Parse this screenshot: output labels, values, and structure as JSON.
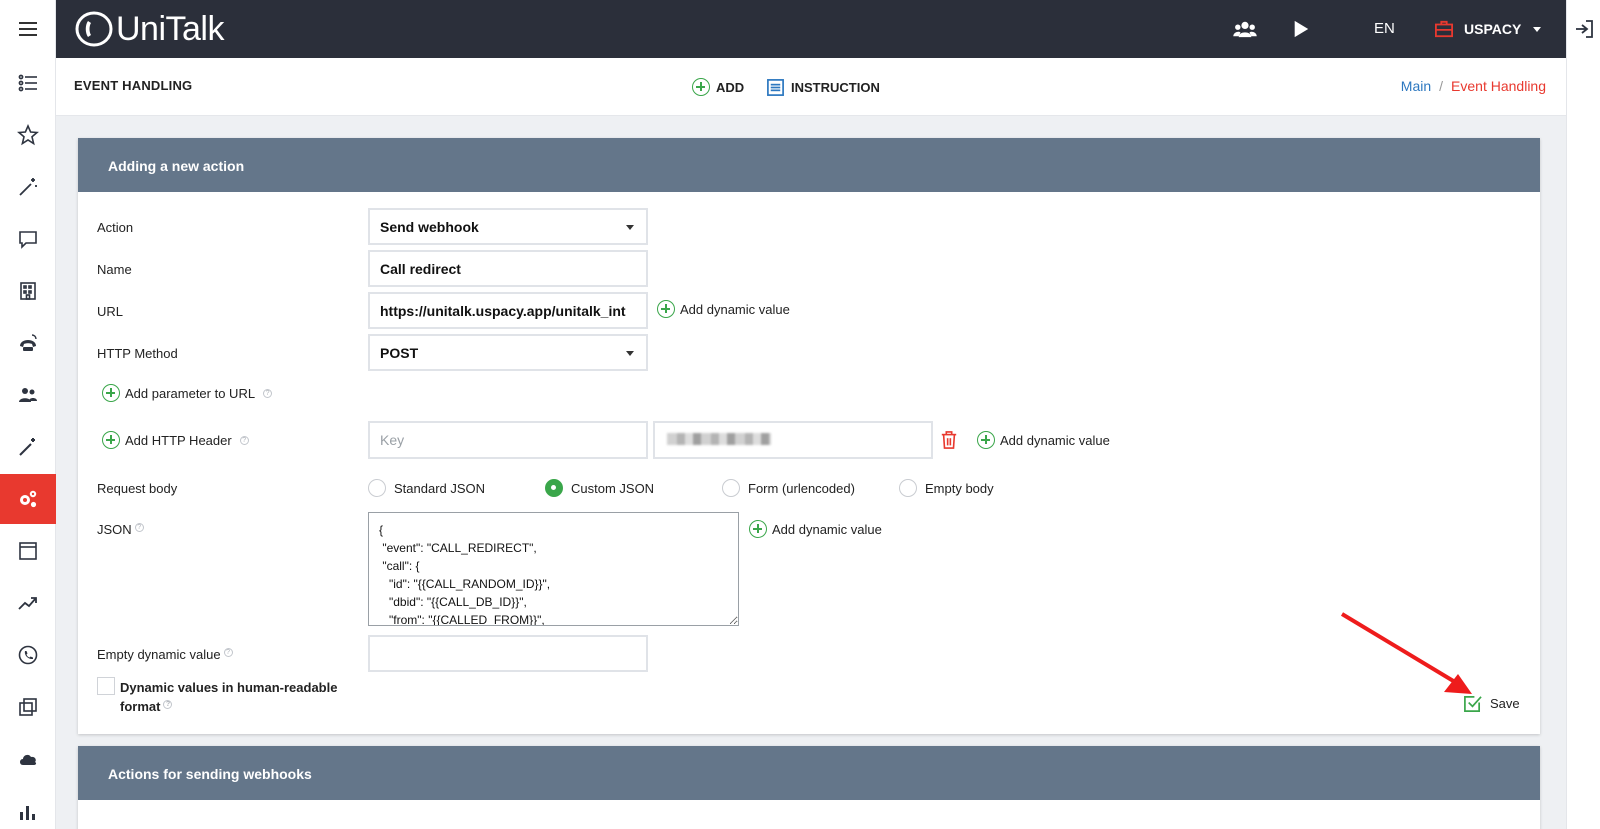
{
  "app": {
    "name": "UniTalk"
  },
  "topbar": {
    "language": "EN",
    "company": "USPACY"
  },
  "sidebar": {
    "items": [
      {
        "icon": "hamburger-menu-icon"
      },
      {
        "icon": "list-icon"
      },
      {
        "icon": "star-icon"
      },
      {
        "icon": "magic-wand-icon"
      },
      {
        "icon": "chat-icon"
      },
      {
        "icon": "building-icon"
      },
      {
        "icon": "phone-ring-icon"
      },
      {
        "icon": "team-icon"
      },
      {
        "icon": "magic-wand-icon"
      },
      {
        "icon": "gears-icon",
        "active": true
      },
      {
        "icon": "window-icon"
      },
      {
        "icon": "trend-icon"
      },
      {
        "icon": "phone-circle-icon"
      },
      {
        "icon": "copy-icon"
      },
      {
        "icon": "cloud-icon"
      },
      {
        "icon": "bar-chart-icon"
      }
    ]
  },
  "header": {
    "title": "EVENT HANDLING",
    "add_label": "ADD",
    "instruction_label": "INSTRUCTION",
    "breadcrumb": {
      "main": "Main",
      "separator": "/",
      "current": "Event Handling"
    }
  },
  "form": {
    "panel_title": "Adding a new action",
    "action": {
      "label": "Action",
      "value": "Send webhook"
    },
    "name": {
      "label": "Name",
      "value": "Call redirect"
    },
    "url": {
      "label": "URL",
      "value": "https://unitalk.uspacy.app/unitalk_int"
    },
    "http_method": {
      "label": "HTTP Method",
      "value": "POST"
    },
    "add_parameter_label": "Add parameter to URL",
    "add_header_label": "Add HTTP Header",
    "header_key_placeholder": "Key",
    "add_dynamic_value_label": "Add dynamic value",
    "request_body": {
      "label": "Request body",
      "options": [
        "Standard JSON",
        "Custom JSON",
        "Form (urlencoded)",
        "Empty body"
      ],
      "selected": "Custom JSON"
    },
    "json": {
      "label": "JSON",
      "value": "{\n \"event\": \"CALL_REDIRECT\",\n \"call\": {\n   \"id\": \"{{CALL_RANDOM_ID}}\",\n   \"dbid\": \"{{CALL_DB_ID}}\",\n   \"from\": \"{{CALLED_FROM}}\","
    },
    "empty_dynamic_value": {
      "label": "Empty dynamic value",
      "value": ""
    },
    "human_readable": {
      "label": "Dynamic values in human-readable format",
      "checked": false
    },
    "save_label": "Save",
    "help_glyph": "?"
  },
  "second_panel": {
    "title": "Actions for sending webhooks"
  },
  "colors": {
    "accent": "#e8392f",
    "green": "#3aa64a",
    "panel_header": "#64768a",
    "topbar": "#2b2f3a",
    "link": "#2d78c0"
  }
}
